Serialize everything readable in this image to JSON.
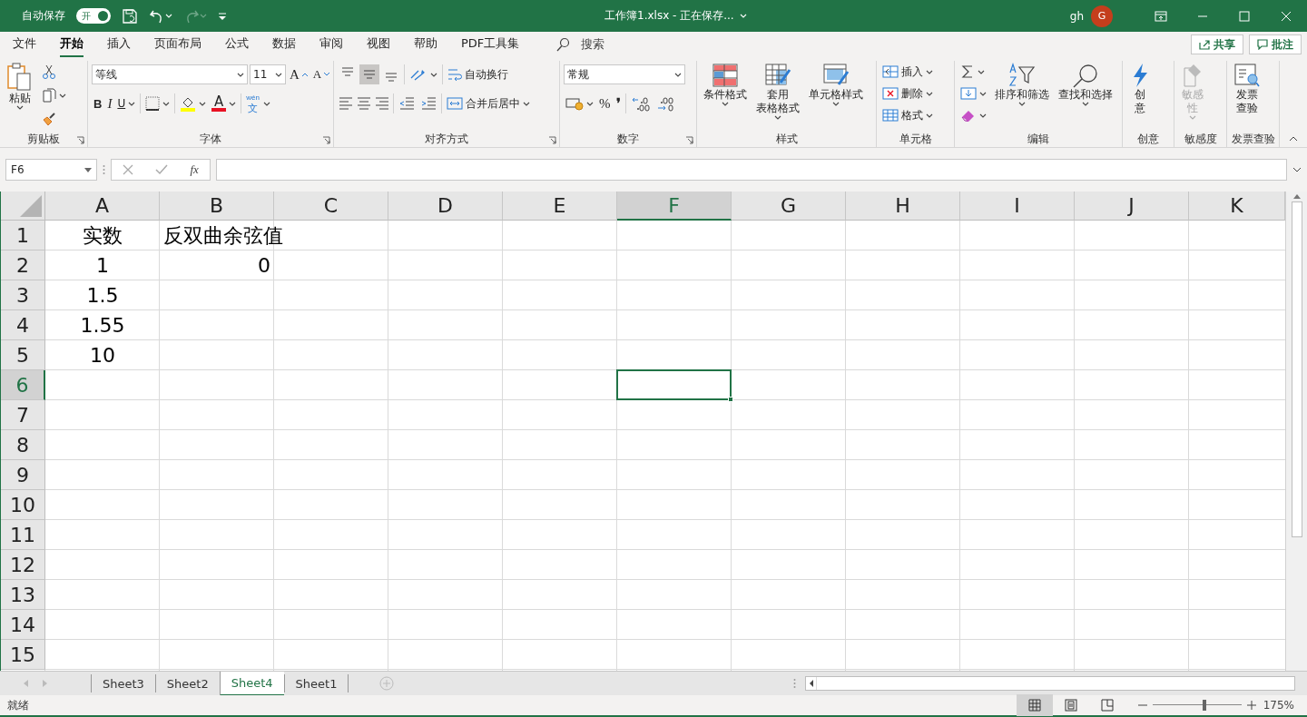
{
  "title_bar": {
    "autosave_label": "自动保存",
    "autosave_toggle": {
      "label": "开",
      "on": true
    },
    "redo_disabled": true,
    "title": "工作簿1.xlsx - 正在保存...",
    "user": "gh",
    "avatar": "G"
  },
  "menu_tabs": [
    {
      "label": "文件",
      "selected": false
    },
    {
      "label": "开始",
      "selected": true
    },
    {
      "label": "插入",
      "selected": false
    },
    {
      "label": "页面布局",
      "selected": false
    },
    {
      "label": "公式",
      "selected": false
    },
    {
      "label": "数据",
      "selected": false
    },
    {
      "label": "审阅",
      "selected": false
    },
    {
      "label": "视图",
      "selected": false
    },
    {
      "label": "帮助",
      "selected": false
    },
    {
      "label": "PDF工具集",
      "selected": false
    }
  ],
  "search": {
    "placeholder": "搜索"
  },
  "share_button": "共享",
  "comments_button": "批注",
  "ribbon": {
    "clipboard": {
      "label": "剪贴板",
      "paste": "粘贴"
    },
    "font": {
      "label": "字体",
      "font_name": "等线",
      "font_size": "11",
      "grow": "A",
      "shrink": "A",
      "bold": "B",
      "italic": "I",
      "underline": "U",
      "font_color": "A",
      "phonetic_top": "wén",
      "phonetic_bottom": "文"
    },
    "alignment": {
      "label": "对齐方式",
      "vertical": [
        {
          "selected": false
        },
        {
          "selected": true
        },
        {
          "selected": false
        }
      ],
      "wrap_text": "自动换行",
      "merge_center": "合并后居中"
    },
    "number": {
      "label": "数字",
      "format": "常规",
      "percent": "%",
      "comma": "❜"
    },
    "styles": {
      "label": "样式",
      "buttons": [
        [
          "条件格式"
        ],
        [
          "套用",
          "表格格式"
        ],
        [
          "单元格样式"
        ]
      ]
    },
    "cells": {
      "label": "单元格",
      "buttons": [
        "插入",
        "删除",
        "格式"
      ]
    },
    "editing": {
      "label": "编辑",
      "buttons": [
        "排序和筛选",
        "查找和选择"
      ]
    },
    "ideas": {
      "label": "创意",
      "button": [
        "创",
        "意"
      ]
    },
    "sensitivity": {
      "label": "敏感度",
      "button": [
        "敏感",
        "性"
      ],
      "disabled": true
    },
    "invoice": {
      "label": "发票查验",
      "button": [
        "发票",
        "查验"
      ]
    }
  },
  "formula_bar": {
    "name_box": "F6",
    "fx": "fx"
  },
  "sheet": {
    "columns": [
      {
        "label": "A",
        "selected": false
      },
      {
        "label": "B",
        "selected": false
      },
      {
        "label": "C",
        "selected": false
      },
      {
        "label": "D",
        "selected": false
      },
      {
        "label": "E",
        "selected": false
      },
      {
        "label": "F",
        "selected": true
      },
      {
        "label": "G",
        "selected": false
      },
      {
        "label": "H",
        "selected": false
      },
      {
        "label": "I",
        "selected": false
      },
      {
        "label": "J",
        "selected": false
      },
      {
        "label": "K",
        "selected": false
      }
    ],
    "rows": [
      {
        "label": "1",
        "selected": false,
        "cells": [
          {
            "text": "实数",
            "kind": "centered"
          },
          {
            "text": "反双曲余弦值",
            "kind": "text"
          }
        ]
      },
      {
        "label": "2",
        "selected": false,
        "cells": [
          {
            "text": "1",
            "kind": "centered"
          },
          {
            "text": "0",
            "kind": "number"
          }
        ]
      },
      {
        "label": "3",
        "selected": false,
        "cells": [
          {
            "text": "1.5",
            "kind": "centered"
          }
        ]
      },
      {
        "label": "4",
        "selected": false,
        "cells": [
          {
            "text": "1.55",
            "kind": "centered"
          }
        ]
      },
      {
        "label": "5",
        "selected": false,
        "cells": [
          {
            "text": "10",
            "kind": "centered"
          }
        ]
      },
      {
        "label": "6",
        "selected": true
      },
      {
        "label": "7",
        "selected": false
      },
      {
        "label": "8",
        "selected": false
      },
      {
        "label": "9",
        "selected": false
      },
      {
        "label": "10",
        "selected": false
      },
      {
        "label": "11",
        "selected": false
      },
      {
        "label": "12",
        "selected": false
      },
      {
        "label": "13",
        "selected": false
      },
      {
        "label": "14",
        "selected": false
      },
      {
        "label": "15",
        "selected": false
      }
    ]
  },
  "sheet_tabs": [
    {
      "label": "Sheet3",
      "selected": false
    },
    {
      "label": "Sheet2",
      "selected": false
    },
    {
      "label": "Sheet4",
      "selected": true
    },
    {
      "label": "Sheet1",
      "selected": false
    }
  ],
  "status_bar": {
    "status": "就绪",
    "views": [
      {
        "selected": true
      },
      {
        "selected": false
      },
      {
        "selected": false
      }
    ],
    "zoom": {
      "level": 0.58,
      "reading": "175%"
    }
  }
}
